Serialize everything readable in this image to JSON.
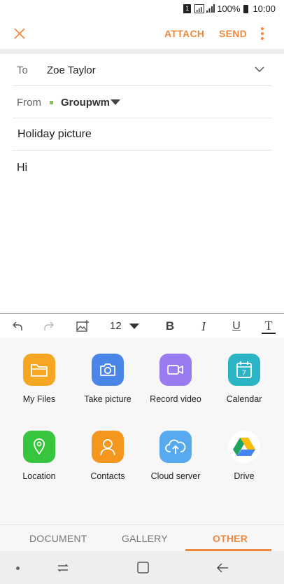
{
  "status_bar": {
    "sim": "1",
    "battery_percent": "100%",
    "time": "10:00"
  },
  "toolbar": {
    "attach_label": "ATTACH",
    "send_label": "SEND"
  },
  "compose": {
    "to_label": "To",
    "to_value": "Zoe Taylor",
    "from_label": "From",
    "from_value": "Groupwm",
    "subject": "Holiday picture",
    "body": "Hi"
  },
  "format_toolbar": {
    "font_size": "12",
    "bold": "B",
    "italic": "I",
    "underline": "U",
    "text_color": "T"
  },
  "attach_options": [
    {
      "label": "My Files",
      "icon": "folder-icon",
      "color": "#f5a623"
    },
    {
      "label": "Take picture",
      "icon": "camera-icon",
      "color": "#4a86e8"
    },
    {
      "label": "Record video",
      "icon": "video-camera-icon",
      "color": "#9b7bf2"
    },
    {
      "label": "Calendar",
      "icon": "calendar-icon",
      "color": "#2ab4c6"
    },
    {
      "label": "Location",
      "icon": "location-pin-icon",
      "color": "#36c53c"
    },
    {
      "label": "Contacts",
      "icon": "contacts-icon",
      "color": "#f5961e"
    },
    {
      "label": "Cloud server",
      "icon": "cloud-upload-icon",
      "color": "#57a9f0"
    },
    {
      "label": "Drive",
      "icon": "google-drive-icon",
      "color": "#ffffff"
    }
  ],
  "calendar_day": "7",
  "tabs": [
    {
      "label": "DOCUMENT"
    },
    {
      "label": "GALLERY"
    },
    {
      "label": "OTHER",
      "active": true
    }
  ],
  "colors": {
    "accent": "#f0883e"
  }
}
